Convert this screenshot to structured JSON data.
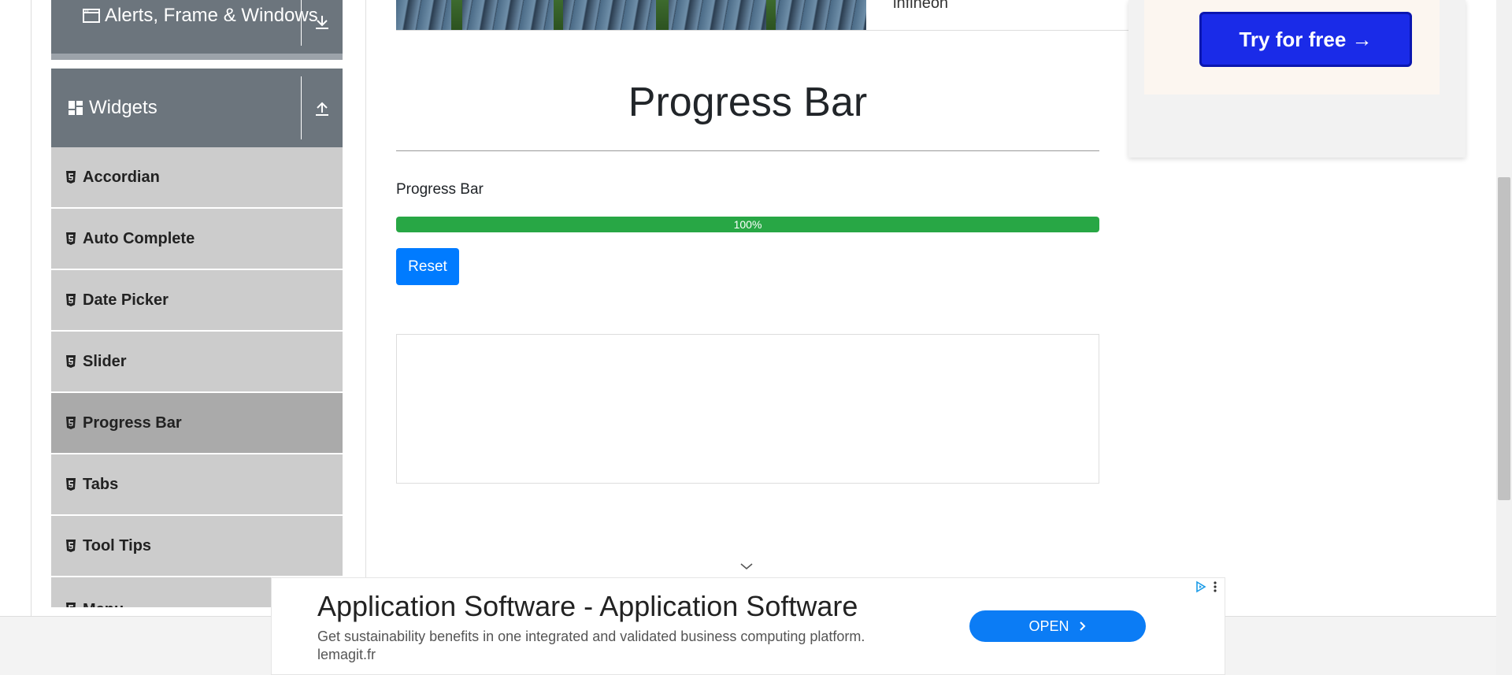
{
  "sidebar": {
    "groups": [
      {
        "label": "Alerts, Frame & Windows",
        "icon": "window-icon",
        "toggle_icon": "download-arrow-icon"
      },
      {
        "label": "Widgets",
        "icon": "widgets-icon",
        "toggle_icon": "upload-arrow-icon"
      }
    ],
    "items": [
      {
        "label": "Accordian",
        "icon": "html5-icon"
      },
      {
        "label": "Auto Complete",
        "icon": "html5-icon"
      },
      {
        "label": "Date Picker",
        "icon": "html5-icon"
      },
      {
        "label": "Slider",
        "icon": "html5-icon"
      },
      {
        "label": "Progress Bar",
        "icon": "html5-icon",
        "active": true
      },
      {
        "label": "Tabs",
        "icon": "html5-icon"
      },
      {
        "label": "Tool Tips",
        "icon": "html5-icon"
      },
      {
        "label": "Menu",
        "icon": "html5-icon"
      }
    ]
  },
  "top_banner": {
    "text": "infineon"
  },
  "right_ad": {
    "button_label": "Try for free →",
    "button_color": "#1a2be8"
  },
  "main": {
    "title": "Progress Bar",
    "progress_label": "Progress Bar",
    "progress_value": 100,
    "progress_text": "100%",
    "progress_color": "#28a745",
    "reset_label": "Reset",
    "reset_color": "#007bff"
  },
  "bottom_ad": {
    "headline": "Application Software - Application Software",
    "description": "Get sustainability benefits in one integrated and validated business computing platform.",
    "domain": "lemagit.fr",
    "open_label": "OPEN",
    "open_color": "#0b7cf5"
  }
}
